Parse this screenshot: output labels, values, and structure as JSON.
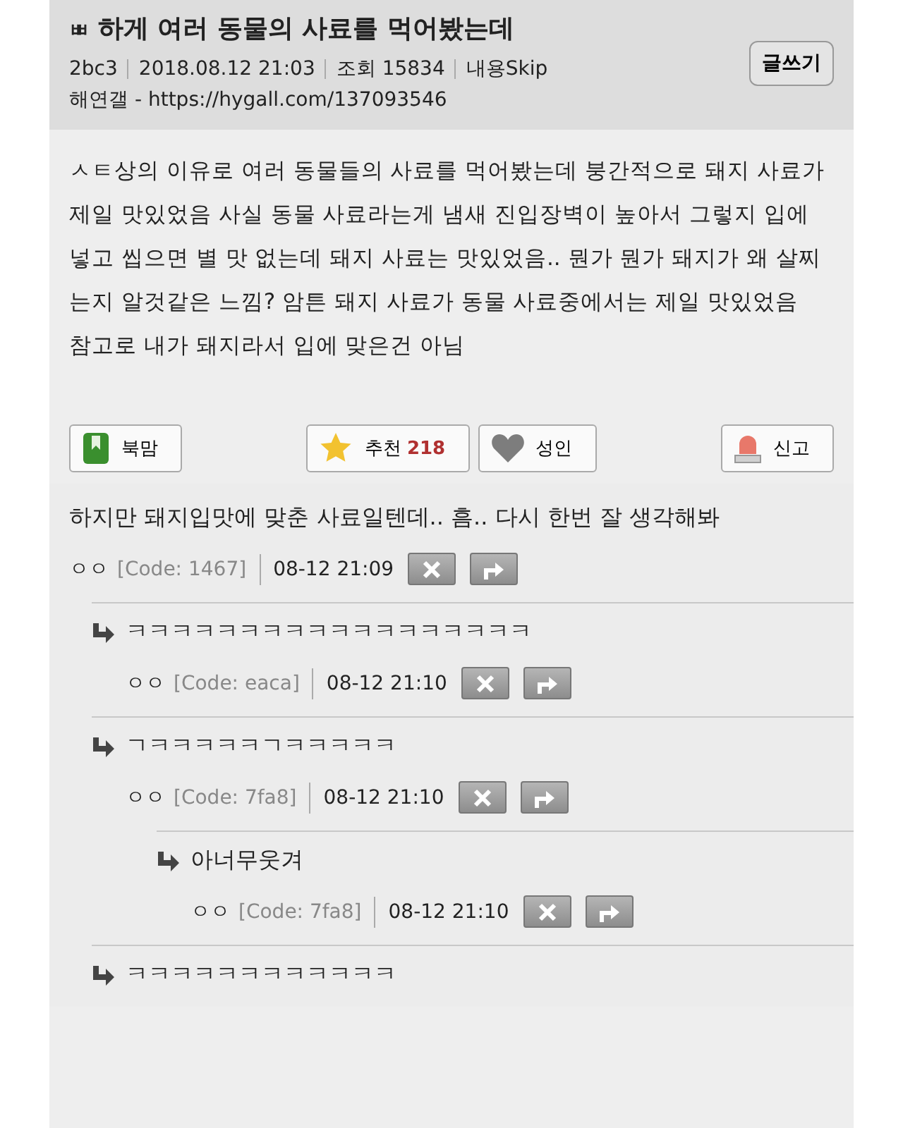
{
  "post": {
    "category_mark": "ㅃ",
    "title": "하게 여러 동물의 사료를 먹어봤는데",
    "author": "2bc3",
    "date": "2018.08.12 21:03",
    "views": "조회 15834",
    "content_skip": "내용Skip",
    "source": "해연갤 - https://hygall.com/137093546",
    "write_button": "글쓰기",
    "body": [
      "ㅅㅌ상의 이유로 여러 동물들의 사료를 먹어봤는데 붕간적으로 돼지 사료가 제일 맛있었음 사실 동물 사료라는게 냄새 진입장벽이 높아서 그렇지 입에 넣고 씹으면 별 맛 없는데 돼지 사료는 맛있었음.. 뭔가 뭔가 돼지가 왜 살찌는지 알것같은 느낌? 암튼 돼지 사료가 동물 사료중에서는 제일 맛있었음",
      "참고로 내가 돼지라서 입에 맞은건 아님"
    ]
  },
  "actions": [
    {
      "kind": "bookmark",
      "label": "북맘"
    },
    {
      "kind": "recommend",
      "label": "추천",
      "count": "218"
    },
    {
      "kind": "adult",
      "label": "성인"
    },
    {
      "kind": "report",
      "label": "신고"
    }
  ],
  "comments": [
    {
      "text": "하지만 돼지입맛에 맞춘 사료일텐데.. 흠.. 다시 한번 잘 생각해봐",
      "author": "ㅇㅇ",
      "code": "[Code: 1467]",
      "time": "08-12 21:09",
      "children": [
        {
          "text": "ㅋㅋㅋㅋㅋㅋㅋㅋㅋㅋㅋㅋㅋㅋㅋㅋㅋㅋ",
          "author": "ㅇㅇ",
          "code": "[Code: eaca]",
          "time": "08-12 21:10"
        },
        {
          "text": "ㄱㅋㅋㅋㅋㅋㄱㅋㅋㅋㅋㅋ",
          "author": "ㅇㅇ",
          "code": "[Code: 7fa8]",
          "time": "08-12 21:10",
          "children": [
            {
              "text": "아너무웃겨",
              "author": "ㅇㅇ",
              "code": "[Code: 7fa8]",
              "time": "08-12 21:10"
            }
          ]
        },
        {
          "text": "ㅋㅋㅋㅋㅋㅋㅋㅋㅋㅋㅋㅋ"
        }
      ]
    }
  ]
}
